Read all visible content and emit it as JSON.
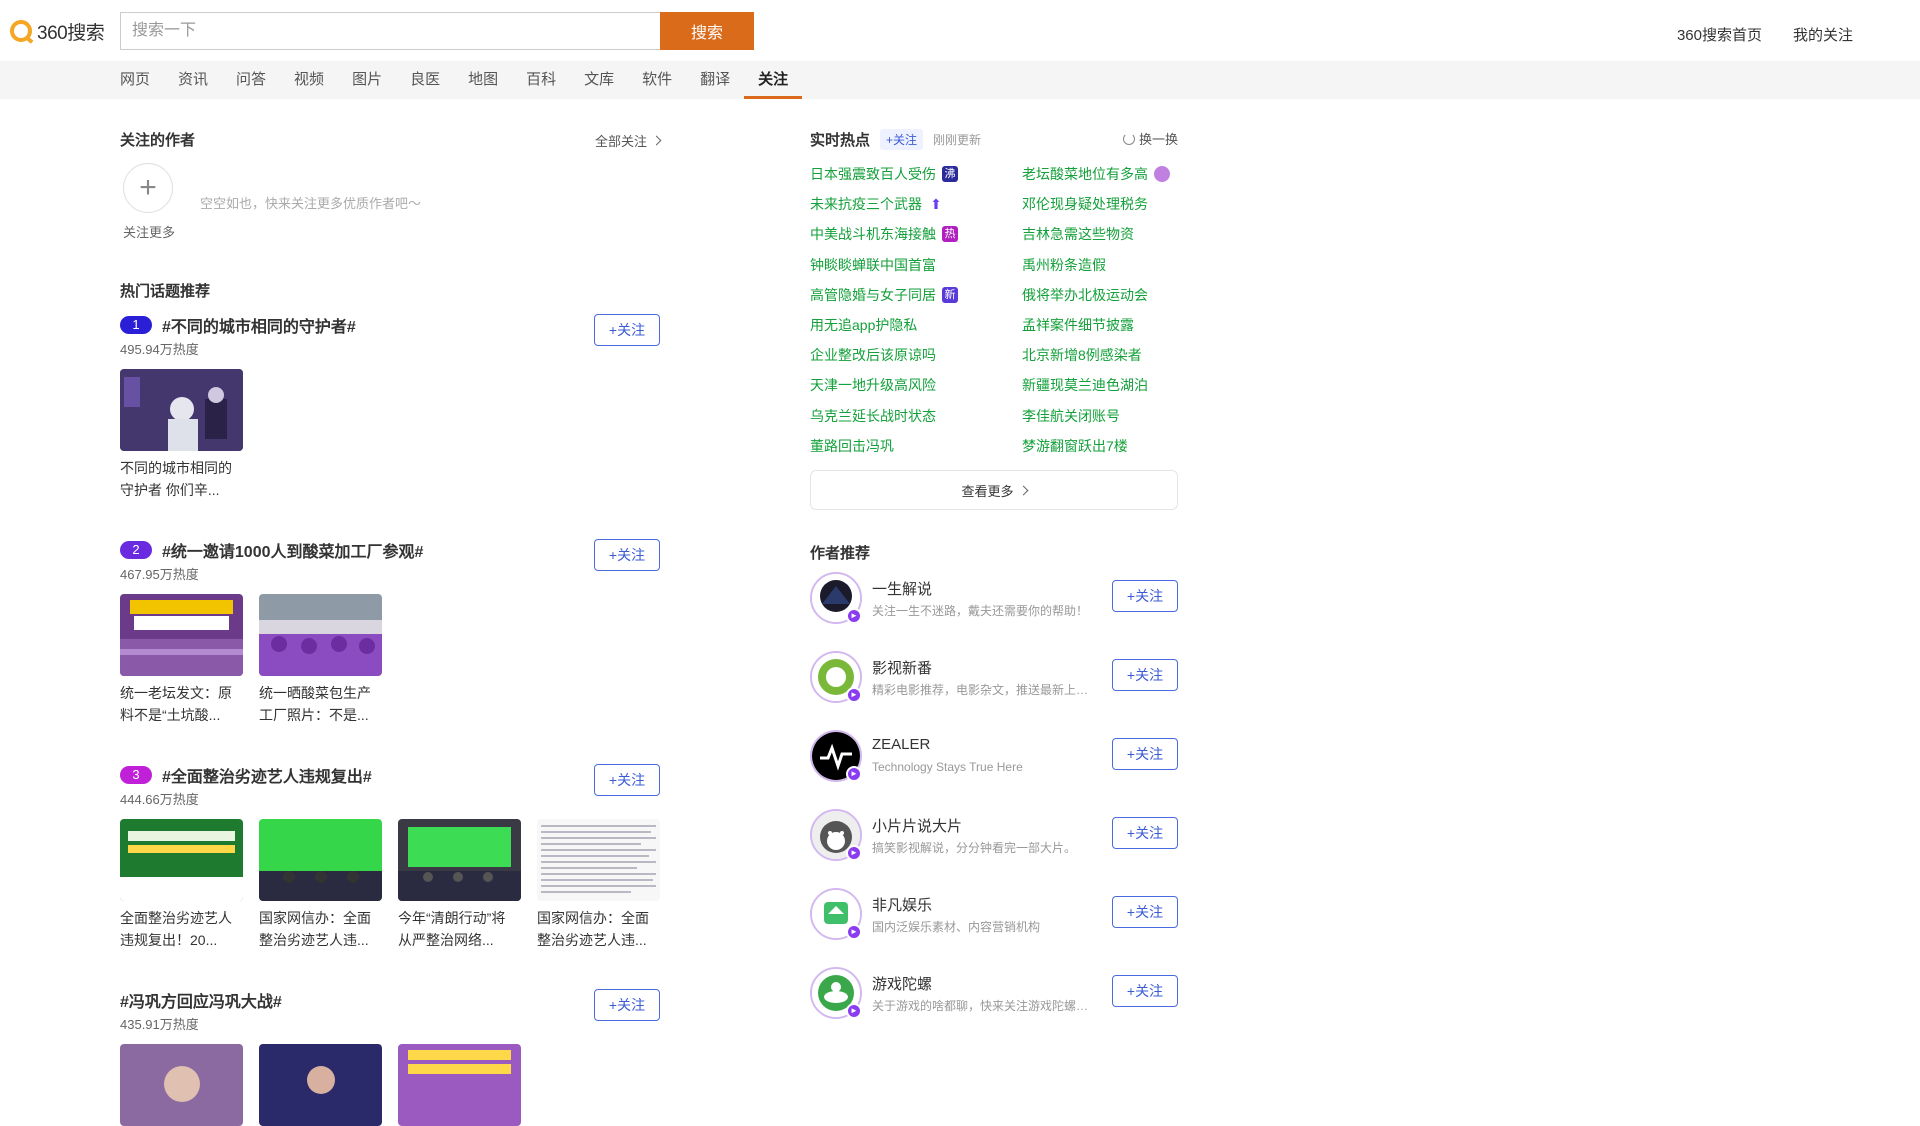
{
  "header": {
    "logo_text": "360搜索",
    "search_placeholder": "搜索一下",
    "search_button": "搜索",
    "links": [
      "360搜索首页",
      "我的关注"
    ]
  },
  "nav": {
    "items": [
      "网页",
      "资讯",
      "问答",
      "视频",
      "图片",
      "良医",
      "地图",
      "百科",
      "文库",
      "软件",
      "翻译",
      "关注"
    ],
    "active": "关注"
  },
  "followed_authors": {
    "title": "关注的作者",
    "all_link": "全部关注",
    "add_label": "关注更多",
    "empty_text": "空空如也，快来关注更多优质作者吧～"
  },
  "hot_topics": {
    "title": "热门话题推荐",
    "follow_label": "+关注",
    "items": [
      {
        "rank": "1",
        "name": "#不同的城市相同的守护者#",
        "heat": "495.94万热度",
        "thumbs": [
          {
            "caption": "不同的城市相同的守护者 你们辛..."
          }
        ]
      },
      {
        "rank": "2",
        "name": "#统一邀请1000人到酸菜加工厂参观#",
        "heat": "467.95万热度",
        "thumbs": [
          {
            "caption": "统一老坛发文：原料不是“土坑酸..."
          },
          {
            "caption": "统一晒酸菜包生产工厂照片：不是..."
          }
        ]
      },
      {
        "rank": "3",
        "name": "#全面整治劣迹艺人违规复出#",
        "heat": "444.66万热度",
        "thumbs": [
          {
            "caption": "全面整治劣迹艺人违规复出！20..."
          },
          {
            "caption": "国家网信办：全面整治劣迹艺人违..."
          },
          {
            "caption": "今年“清朗行动”将从严整治网络..."
          },
          {
            "caption": "国家网信办：全面整治劣迹艺人违..."
          }
        ]
      },
      {
        "rank": "",
        "name": "#冯巩方回应冯巩大战#",
        "heat": "435.91万热度",
        "thumbs": []
      }
    ]
  },
  "realtime_hot": {
    "title": "实时热点",
    "tag": "+关注",
    "updated": "刚刚更新",
    "refresh": "换一换",
    "left": [
      {
        "text": "日本强震致百人受伤",
        "badge": "沸"
      },
      {
        "text": "未来抗疫三个武器",
        "badge": "up"
      },
      {
        "text": "中美战斗机东海接触",
        "badge": "热"
      },
      {
        "text": "钟睒睒蝉联中国首富",
        "badge": ""
      },
      {
        "text": "高管隐婚与女子同居",
        "badge": "新"
      },
      {
        "text": "用无追app护隐私",
        "badge": ""
      },
      {
        "text": "企业整改后该原谅吗",
        "badge": ""
      },
      {
        "text": "天津一地升级高风险",
        "badge": ""
      },
      {
        "text": "乌克兰延长战时状态",
        "badge": ""
      },
      {
        "text": "董路回击冯巩",
        "badge": ""
      }
    ],
    "right": [
      {
        "text": "老坛酸菜地位有多高",
        "badge": "img"
      },
      {
        "text": "邓伦现身疑处理税务",
        "badge": ""
      },
      {
        "text": "吉林急需这些物资",
        "badge": ""
      },
      {
        "text": "禹州粉条造假",
        "badge": ""
      },
      {
        "text": "俄将举办北极运动会",
        "badge": ""
      },
      {
        "text": "孟祥案件细节披露",
        "badge": ""
      },
      {
        "text": "北京新增8例感染者",
        "badge": ""
      },
      {
        "text": "新疆现莫兰迪色湖泊",
        "badge": ""
      },
      {
        "text": "李佳航关闭账号",
        "badge": ""
      },
      {
        "text": "梦游翻窗跃出7楼",
        "badge": ""
      }
    ],
    "more": "查看更多"
  },
  "author_recommend": {
    "title": "作者推荐",
    "follow_label": "+关注",
    "items": [
      {
        "name": "一生解说",
        "desc": "关注一生不迷路，戴夫还需要你的帮助！"
      },
      {
        "name": "影视新番",
        "desc": "精彩电影推荐，电影杂文，推送最新上映电影资讯"
      },
      {
        "name": "ZEALER",
        "desc": "Technology Stays True Here"
      },
      {
        "name": "小片片说大片",
        "desc": "搞笑影视解说，分分钟看完一部大片。"
      },
      {
        "name": "非凡娱乐",
        "desc": "国内泛娱乐素材、内容营销机构"
      },
      {
        "name": "游戏陀螺",
        "desc": "关于游戏的啥都聊，快来关注游戏陀螺吧！"
      }
    ]
  },
  "colors": {
    "accent": "#d96b1b",
    "hot_text": "#14a03a",
    "follow_blue": "#3b5bd6",
    "rank1": "#2a1fd6",
    "rank2": "#6a2be0",
    "rank3": "#c020d8"
  }
}
